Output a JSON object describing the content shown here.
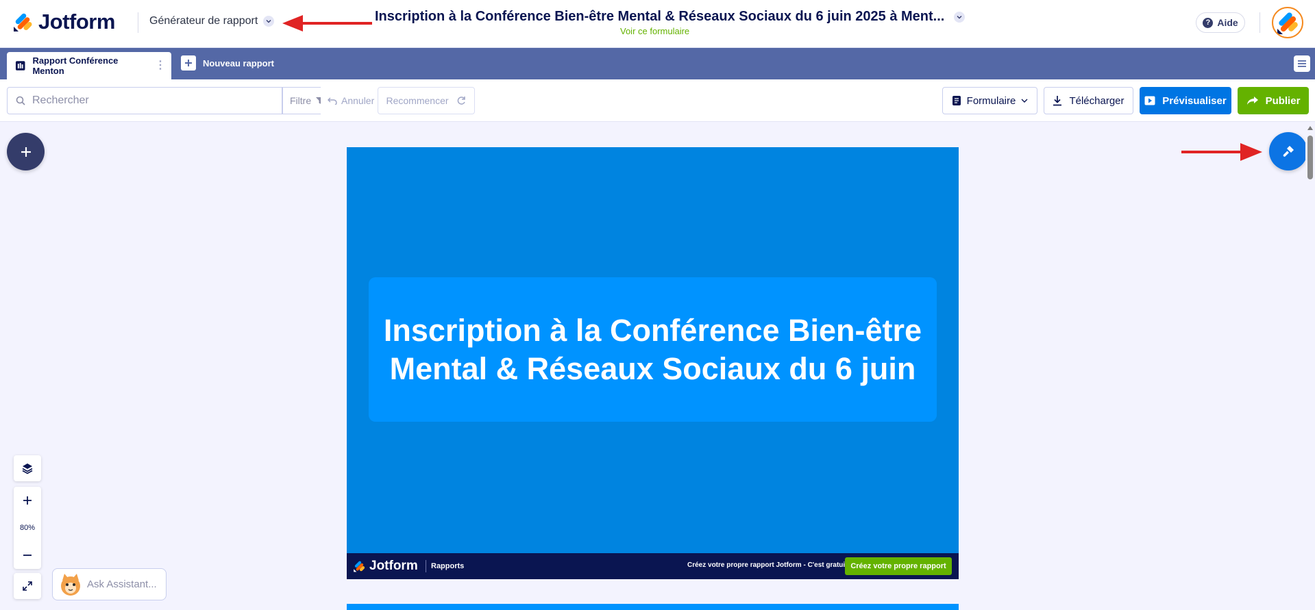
{
  "header": {
    "logo_text": "Jotform",
    "builder_switch_label": "Générateur de rapport",
    "form_title": "Inscription à la Conférence Bien-être Mental & Réseaux Sociaux du 6 juin 2025 à Ment...",
    "form_link": "Voir ce formulaire",
    "help_label": "Aide"
  },
  "tabs": {
    "active_label": "Rapport Conférence Menton",
    "new_label": "Nouveau rapport"
  },
  "toolbar": {
    "search_placeholder": "Rechercher",
    "filter_label": "Filtre",
    "undo_label": "Annuler",
    "reset_label": "Recommencer",
    "form_label": "Formulaire",
    "download_label": "Télécharger",
    "preview_label": "Prévisualiser",
    "publish_label": "Publier"
  },
  "report": {
    "title": "Inscription à la Conférence Bien-être Mental & Réseaux Sociaux du 6 juin",
    "footer_logo": "Jotform",
    "footer_section": "Rapports",
    "footer_promo": "Créez votre propre rapport Jotform - C'est gratuit",
    "footer_cta": "Créez votre propre rapport"
  },
  "zoom": {
    "value": "80%"
  },
  "assistant": {
    "label": "Ask Assistant..."
  },
  "colors": {
    "brand_navy": "#0a1551",
    "tab_bar": "#5468a6",
    "preview_blue": "#0075e3",
    "publish_green": "#64b200",
    "page_blue": "#0084e0",
    "title_box_blue": "#0093ff",
    "annotation_red": "#e02424"
  }
}
